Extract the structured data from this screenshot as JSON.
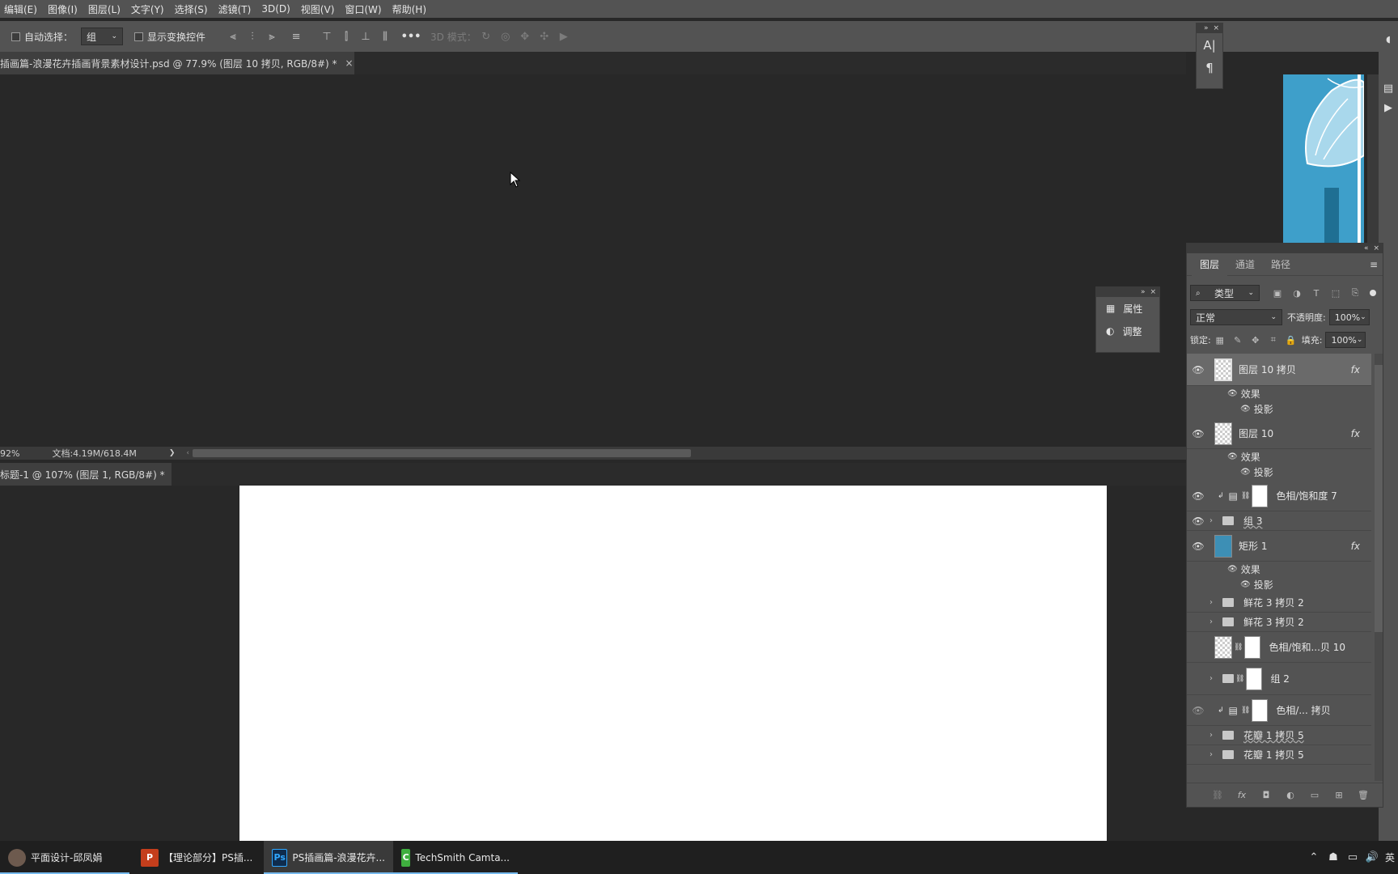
{
  "menubar": [
    "编辑(E)",
    "图像(I)",
    "图层(L)",
    "文字(Y)",
    "选择(S)",
    "滤镜(T)",
    "3D(D)",
    "视图(V)",
    "窗口(W)",
    "帮助(H)"
  ],
  "options": {
    "auto_select_label": "自动选择：",
    "auto_select_value": "组",
    "show_transform_label": "显示变换控件",
    "mode_3d_label": "3D 模式：",
    "more": "•••"
  },
  "doc1": {
    "tab_title": "插画篇-浪漫花卉插画背景素材设计.psd @ 77.9% (图层 10 拷贝, RGB/8#) *",
    "close": "×",
    "zoom": "92%",
    "doc_info": "文档:4.19M/618.4M",
    "nav_arrow": "❯"
  },
  "doc2": {
    "tab_title": "标题-1 @ 107% (图层 1, RGB/8#) *",
    "close": "×"
  },
  "char_panel": {
    "a_icon": "A|",
    "para_icon": "¶"
  },
  "props_panel": {
    "properties": "属性",
    "adjustments": "调整"
  },
  "layers_panel": {
    "tabs": [
      "图层",
      "通道",
      "路径"
    ],
    "filter_kind": "类型",
    "blend_mode": "正常",
    "opacity_label": "不透明度:",
    "opacity_value": "100%",
    "lock_label": "锁定:",
    "fill_label": "填充:",
    "fill_value": "100%",
    "effects_label": "效果",
    "shadow_label": "投影",
    "fx": "fx",
    "layers": [
      "图层 10 拷贝",
      "图层 10",
      "色相/饱和度 7",
      "组 3",
      "矩形 1",
      "鲜花 3 拷贝 2",
      "鲜花 3 拷贝 2",
      "色相/饱和...贝 10",
      "组 2",
      "色相/... 拷贝",
      "花瓣 1 拷贝 5",
      "花瓣 1 拷贝 5"
    ]
  },
  "taskbar": {
    "items": [
      "平面设计-邱凤娟",
      "【理论部分】PS插...",
      "PS插画篇-浪漫花卉...",
      "TechSmith Camta..."
    ],
    "ps_icon": "Ps",
    "ppt_icon": "P",
    "cam_icon": "C",
    "lang": "英"
  }
}
